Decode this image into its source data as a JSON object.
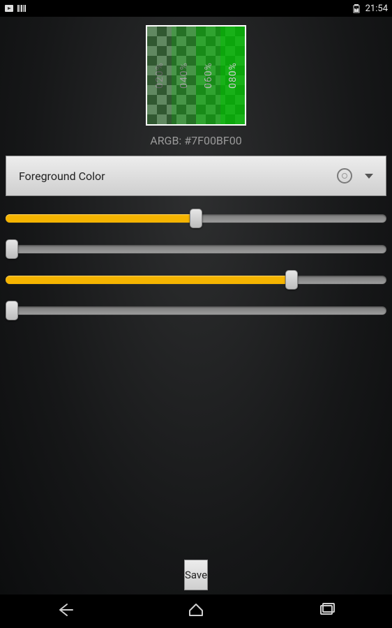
{
  "statusbar": {
    "time": "21:54"
  },
  "preview": {
    "argb_label": "ARGB: #7F00BF00",
    "color_hex": "#00BF00",
    "bars": [
      {
        "label": "020%",
        "opacity": 0.2
      },
      {
        "label": "040%",
        "opacity": 0.4
      },
      {
        "label": "060%",
        "opacity": 0.6
      },
      {
        "label": "080%",
        "opacity": 0.8
      }
    ]
  },
  "dropdown": {
    "selected_label": "Foreground Color"
  },
  "sliders": [
    {
      "name": "alpha",
      "value_pct": 50,
      "fill_color": "#f5b400"
    },
    {
      "name": "red",
      "value_pct": 0,
      "fill_color": "#f5b400"
    },
    {
      "name": "green",
      "value_pct": 75,
      "fill_color": "#f5b400"
    },
    {
      "name": "blue",
      "value_pct": 0,
      "fill_color": "#f5b400"
    }
  ],
  "save_button_label": "Save"
}
